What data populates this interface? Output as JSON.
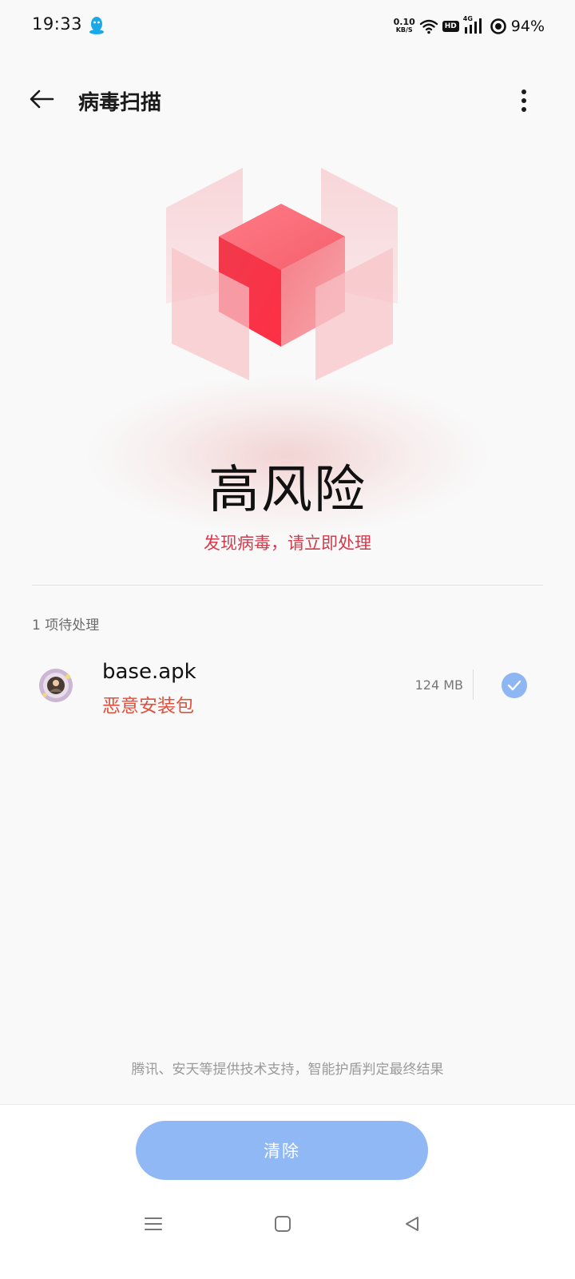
{
  "status_bar": {
    "time": "19:33",
    "net_speed_value": "0.10",
    "net_speed_unit": "KB/S",
    "hd_label": "HD",
    "signal_label": "4G",
    "battery": "94%",
    "icons": [
      "qq-icon",
      "wifi-icon",
      "signal-icon",
      "battery-icon"
    ]
  },
  "header": {
    "title": "病毒扫描",
    "back_icon": "arrow-left-icon",
    "more_icon": "more-vertical-icon"
  },
  "result": {
    "level": "高风险",
    "message": "发现病毒，请立即处理",
    "accent_color": "#d6394b"
  },
  "pending": {
    "label": "1 项待处理",
    "items": [
      {
        "name": "base.apk",
        "tag": "恶意安装包",
        "size": "124 MB",
        "checked": true
      }
    ]
  },
  "footer": {
    "note": "腾讯、安天等提供技术支持，智能护盾判定最终结果",
    "clear_label": "清除",
    "button_color": "#8fb8f5"
  },
  "nav": {
    "icons": [
      "menu-icon",
      "home-square-icon",
      "back-triangle-icon"
    ]
  }
}
